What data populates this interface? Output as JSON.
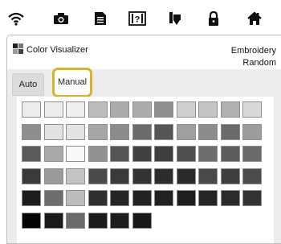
{
  "topbar": {
    "icons": [
      "wifi-icon",
      "camera-icon",
      "document-icon",
      "help-icon",
      "thread-spool-icon",
      "lock-icon",
      "home-icon"
    ]
  },
  "panel": {
    "title": "Color Visualizer",
    "mode_line1": "Embroidery",
    "mode_line2": "Random"
  },
  "tabs": {
    "auto_label": "Auto",
    "manual_label": "Manual",
    "active": "Manual"
  },
  "colors": {
    "highlight": "#d8b32a",
    "panel_bg": "#ececec"
  },
  "swatch_rows": [
    [
      "#ececec",
      "#ececec",
      "#eeeeee",
      "#bcbcbc",
      "#ababab",
      "#ababab",
      "#8f8f8f",
      "#cfcfcf",
      "#c4c4c4",
      "#b0b0b0",
      "#d9d9d9"
    ],
    [
      "#8e8e8e",
      "#e2e2e2",
      "#e4e4e4",
      "#a6a6a6",
      "#8b8b8b",
      "#6b6b6b",
      "#555555",
      "#9f9f9f",
      "#8c8c8c",
      "#6a6a6a",
      "#9d9d9d"
    ],
    [
      "#5a5a5a",
      "#a9a9a9",
      "#f8f8f8",
      "#919191",
      "#555555",
      "#414141",
      "#3e3e3e",
      "#4f4f4f",
      "#6e6e6e",
      "#5c5c5c",
      "#6a6a6a"
    ],
    [
      "#3a3a3a",
      "#9a9a9a",
      "#c4c4c4",
      "#4a4a4a",
      "#3a3a3a",
      "#333333",
      "#2c2c2c",
      "#2a2a2a",
      "#494949",
      "#3e3e3e",
      "#4b4b4b"
    ],
    [
      "#1d1d1d",
      "#6d6d6d",
      "#bcbcbc",
      "#2f2f2f",
      "#252525",
      "#232323",
      "#222222",
      "#1e1e1e",
      "#262626",
      "#2b2b2b",
      "#333333"
    ],
    [
      "#050505",
      "#1a1a1a",
      "#6b6b6b",
      "#1b1b1b",
      "#1d1d1d",
      "#191919"
    ]
  ]
}
